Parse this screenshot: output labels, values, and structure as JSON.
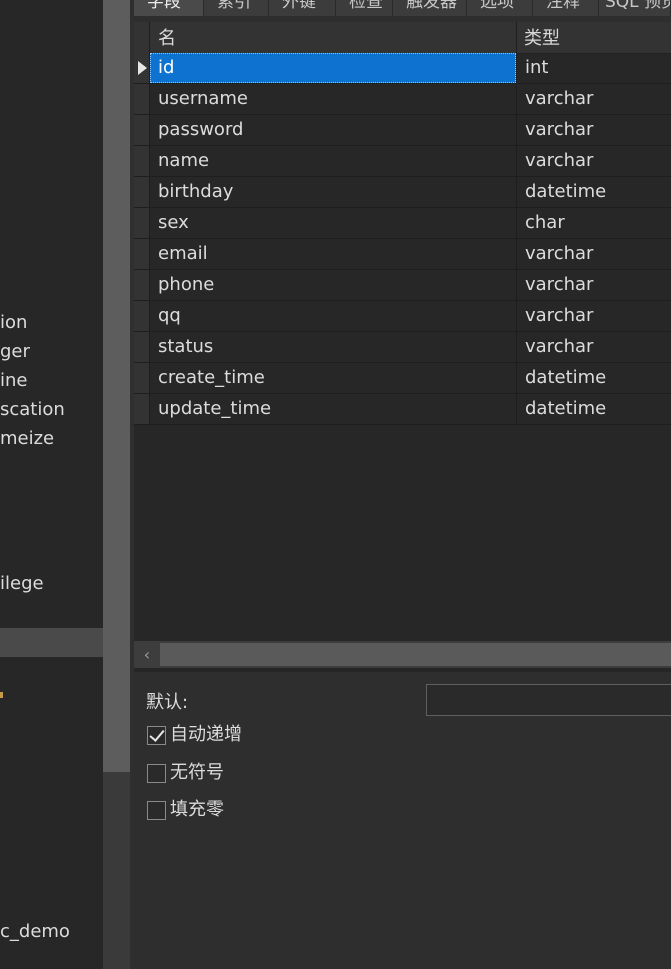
{
  "tabs": [
    {
      "label": "字段",
      "active": true
    },
    {
      "label": "索引",
      "active": false
    },
    {
      "label": "外键",
      "active": false
    },
    {
      "label": "检查",
      "active": false
    },
    {
      "label": "触发器",
      "active": false
    },
    {
      "label": "选项",
      "active": false
    },
    {
      "label": "注释",
      "active": false
    },
    {
      "label": "SQL 预览",
      "active": false
    }
  ],
  "grid": {
    "columns": {
      "name": "名",
      "type": "类型"
    },
    "rows": [
      {
        "name": "id",
        "type": "int",
        "selected": true
      },
      {
        "name": "username",
        "type": "varchar"
      },
      {
        "name": "password",
        "type": "varchar"
      },
      {
        "name": "name",
        "type": "varchar"
      },
      {
        "name": "birthday",
        "type": "datetime"
      },
      {
        "name": "sex",
        "type": "char"
      },
      {
        "name": "email",
        "type": "varchar"
      },
      {
        "name": "phone",
        "type": "varchar"
      },
      {
        "name": "qq",
        "type": "varchar"
      },
      {
        "name": "status",
        "type": "varchar"
      },
      {
        "name": "create_time",
        "type": "datetime"
      },
      {
        "name": "update_time",
        "type": "datetime"
      }
    ]
  },
  "navigator": {
    "items": [
      {
        "text": "ion"
      },
      {
        "text": "ger"
      },
      {
        "text": "ine"
      },
      {
        "text": "scation"
      },
      {
        "text": "meize"
      },
      {
        "text": "ilege"
      },
      {
        "text": "c_demo"
      }
    ]
  },
  "scrollbar": {
    "left_arrow": "‹"
  },
  "properties": {
    "default_label": "默认:",
    "default_value": "",
    "auto_increment": {
      "label": "自动递增",
      "checked": true
    },
    "unsigned": {
      "label": "无符号",
      "checked": false
    },
    "zerofill": {
      "label": "填充零",
      "checked": false
    }
  },
  "colors": {
    "selection": "#0e73d0",
    "background": "#2b2b2b"
  }
}
